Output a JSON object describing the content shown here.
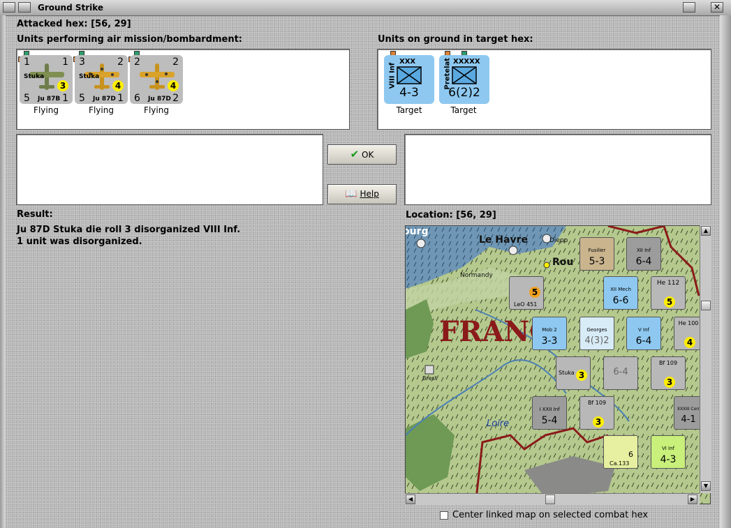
{
  "window": {
    "title": "Ground Strike"
  },
  "attacked_hex": {
    "label": "Attacked hex:",
    "value": "[56, 29]"
  },
  "air_units": {
    "heading": "Units performing air mission/bombardment:",
    "items": [
      {
        "top_left": "1",
        "top_right": "1",
        "name": "Stuka",
        "badge": "3",
        "bottom_left": "5",
        "type": "Ju 87B",
        "bottom_right": "1",
        "status": "Flying",
        "camo": "green"
      },
      {
        "top_left": "3",
        "top_right": "2",
        "name": "Stuka",
        "badge": "4",
        "bottom_left": "5",
        "type": "Ju 87D",
        "bottom_right": "1",
        "status": "Flying",
        "camo": "desert"
      },
      {
        "top_left": "2",
        "top_right": "2",
        "name": "",
        "badge": "4",
        "bottom_left": "6",
        "type": "Ju 87D",
        "bottom_right": "2",
        "status": "Flying",
        "camo": "desert"
      }
    ]
  },
  "ground_units": {
    "heading": "Units on ground in target hex:",
    "items": [
      {
        "side": "VIII Inf",
        "size": "XXX",
        "strength": "4-3",
        "status": "Target"
      },
      {
        "side": "Pretelat",
        "size": "XXXXX",
        "strength": "6(2)2",
        "status": "Target"
      }
    ]
  },
  "buttons": {
    "ok": "OK",
    "help": "Help"
  },
  "result": {
    "label": "Result:",
    "lines": [
      "Ju 87D Stuka die roll 3 disorganized VIII Inf.",
      "1 unit was disorganized."
    ]
  },
  "location": {
    "label": "Location:",
    "value": "[56, 29]"
  },
  "map": {
    "labels": {
      "country": "FRANC",
      "river": "Loire",
      "city1": "Le Havre",
      "city2": "Rou",
      "region": "Normandy",
      "city3": "Diepp",
      "edge": "ourg",
      "town": "Brest"
    },
    "counters": [
      {
        "name": "Fusilier",
        "size": "XXX",
        "value": "5-3"
      },
      {
        "name": "XII Inf",
        "size": "XXX",
        "value": "6-4"
      },
      {
        "name": "XII Mech",
        "size": "XXX",
        "value": "6-6"
      },
      {
        "name": "He 112",
        "value": "5"
      },
      {
        "name": "LeO 451",
        "value": "5"
      },
      {
        "name": "Mob 2",
        "size": "XXX",
        "value": "3-3"
      },
      {
        "name": "Georges",
        "size": "XXXXX",
        "value": "4(3)2"
      },
      {
        "name": "V Inf",
        "size": "XXX",
        "value": "6-4"
      },
      {
        "name": "He 100",
        "value": "4"
      },
      {
        "name": "Stuka",
        "value": "3"
      },
      {
        "name": "",
        "size": "XXX",
        "value": "6-4"
      },
      {
        "name": "Bf 109",
        "value": "3"
      },
      {
        "name": "I XXII Inf",
        "size": "XXX",
        "value": "5-4"
      },
      {
        "name": "Bf 109",
        "value": "3"
      },
      {
        "name": "XXXIII Corr",
        "size": "XXX",
        "value": "4-1"
      },
      {
        "name": "Ca.133",
        "value": "6"
      },
      {
        "name": "VI Inf",
        "size": "XXX",
        "value": "4-3"
      }
    ]
  },
  "center_option": {
    "label": "Center linked map on selected combat hex",
    "checked": false
  }
}
